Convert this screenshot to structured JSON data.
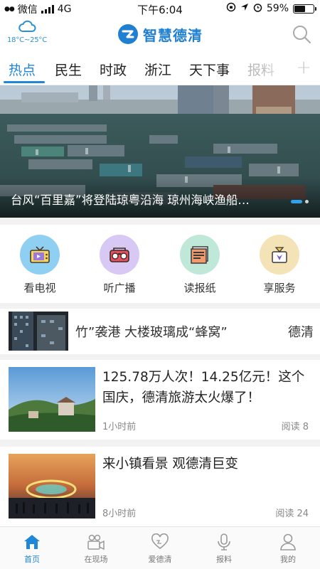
{
  "status_bar": {
    "carrier": "微信",
    "network": "4G",
    "time": "下午6:04",
    "battery": "59%",
    "battery_level": 0.59
  },
  "header": {
    "temperature": "18°C~25°C",
    "app_title": "智慧德清",
    "weather_icon": "cloud-icon",
    "search_icon": "search-icon"
  },
  "tabs": [
    {
      "label": "热点",
      "active": true
    },
    {
      "label": "民生"
    },
    {
      "label": "时政"
    },
    {
      "label": "浙江"
    },
    {
      "label": "天下事"
    },
    {
      "label": "报料"
    }
  ],
  "tabs_add": "+",
  "hero": {
    "caption": "台风“百里嘉”将登陆琼粤沿海 琼州海峡渔船…"
  },
  "services": [
    {
      "label": "看电视",
      "icon": "tv-icon",
      "color": "#8fd0f2"
    },
    {
      "label": "听广播",
      "icon": "radio-icon",
      "color": "#d7c9f4"
    },
    {
      "label": "读报纸",
      "icon": "newspaper-icon",
      "color": "#bfe8d8"
    },
    {
      "label": "享服务",
      "icon": "service-icon",
      "color": "#f4e3b6"
    }
  ],
  "ticker": {
    "text": "竹”袭港 大楼玻璃成“蜂窝”",
    "text_next": "德清"
  },
  "news": [
    {
      "title": "125.78万人次！14.25亿元！这个国庆，德清旅游太火爆了！",
      "time": "1小时前",
      "reads": "阅读 8"
    },
    {
      "title": "来小镇看景 观德清巨变",
      "time": "8小时前",
      "reads": "阅读 24"
    }
  ],
  "bottom_nav": [
    {
      "label": "首页",
      "icon": "home-icon",
      "active": true
    },
    {
      "label": "在现场",
      "icon": "camera-icon"
    },
    {
      "label": "爱德清",
      "icon": "heart-icon"
    },
    {
      "label": "报料",
      "icon": "microphone-icon"
    },
    {
      "label": "我的",
      "icon": "user-icon"
    }
  ],
  "colors": {
    "accent": "#1f86d8",
    "brand": "#1f7fd1"
  }
}
